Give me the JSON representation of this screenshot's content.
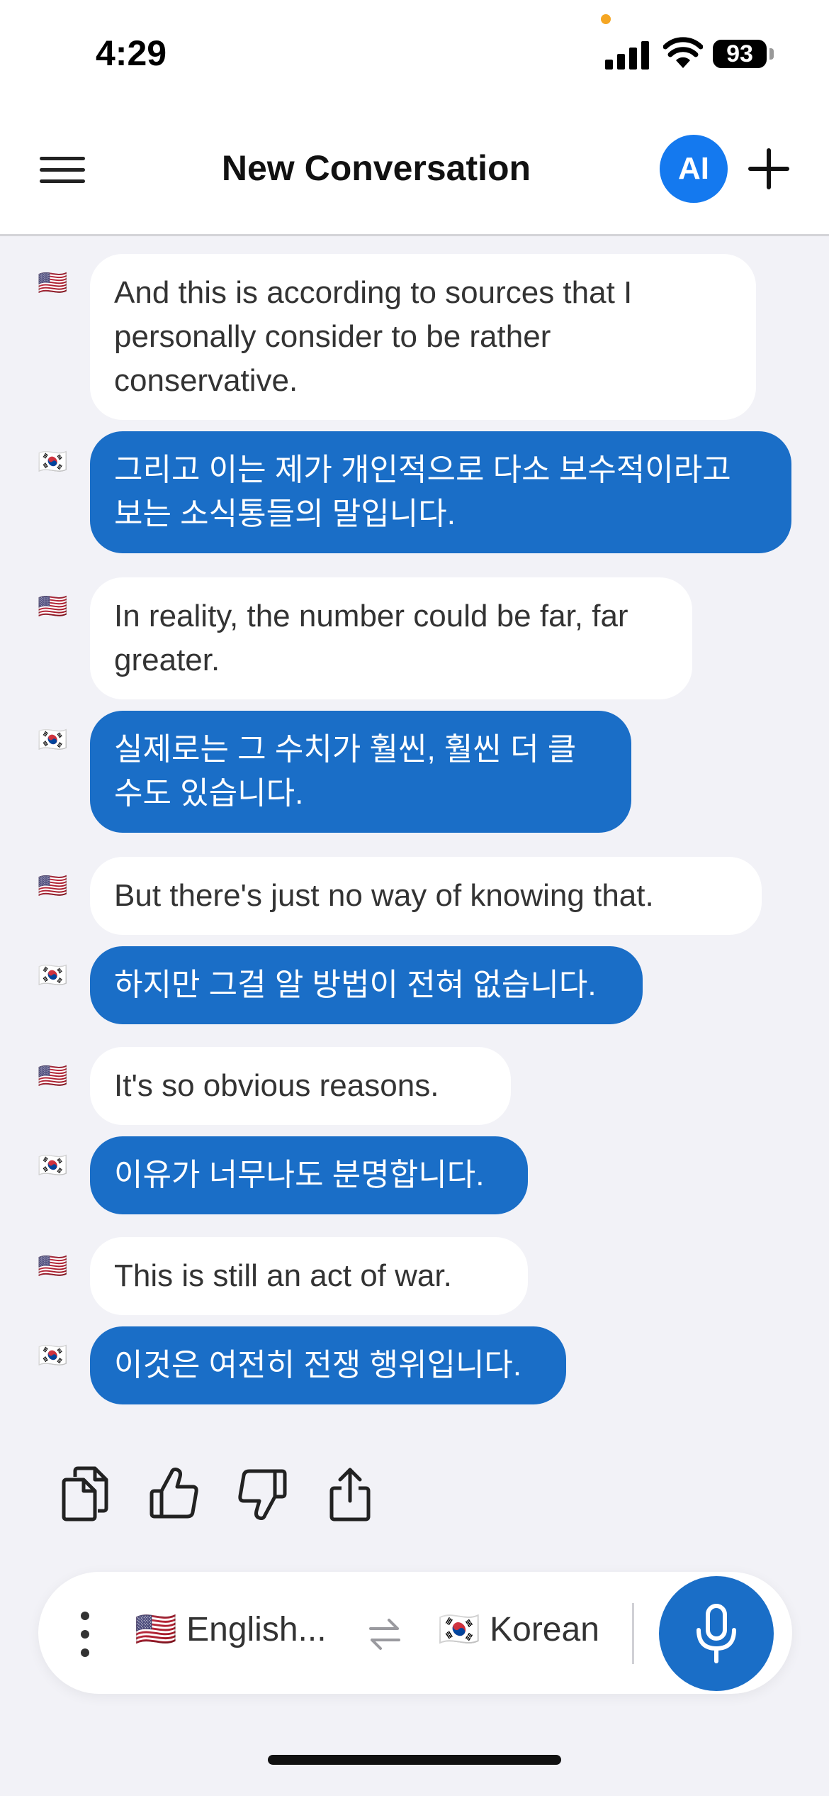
{
  "status_bar": {
    "time": "4:29",
    "battery": "93"
  },
  "header": {
    "title": "New Conversation",
    "ai_label": "AI"
  },
  "messages": [
    {
      "lang": "en",
      "flag": "🇺🇸",
      "text": "And this is according to sources that I personally consider to be rather conservative."
    },
    {
      "lang": "ko",
      "flag": "🇰🇷",
      "text": "그리고 이는 제가 개인적으로 다소 보수적이라고 보는 소식통들의 말입니다."
    },
    {
      "lang": "en",
      "flag": "🇺🇸",
      "text": "In reality, the number could be far, far greater."
    },
    {
      "lang": "ko",
      "flag": "🇰🇷",
      "text": "실제로는 그 수치가 훨씬, 훨씬 더 클 수도 있습니다."
    },
    {
      "lang": "en",
      "flag": "🇺🇸",
      "text": "But there's just no way of knowing that."
    },
    {
      "lang": "ko",
      "flag": "🇰🇷",
      "text": "하지만 그걸 알 방법이 전혀 없습니다."
    },
    {
      "lang": "en",
      "flag": "🇺🇸",
      "text": "It's so obvious reasons."
    },
    {
      "lang": "ko",
      "flag": "🇰🇷",
      "text": "이유가 너무나도 분명합니다."
    },
    {
      "lang": "en",
      "flag": "🇺🇸",
      "text": "This is still an act of war."
    },
    {
      "lang": "ko",
      "flag": "🇰🇷",
      "text": "이것은 여전히 전쟁 행위입니다."
    }
  ],
  "actions": {
    "copy_icon": "copy-icon",
    "like_icon": "thumbs-up-icon",
    "dislike_icon": "thumbs-down-icon",
    "share_icon": "share-icon"
  },
  "language_bar": {
    "source_flag": "🇺🇸",
    "source_label": "English...",
    "target_flag": "🇰🇷",
    "target_label": "Korean",
    "swap_icon": "swap-arrows-icon",
    "mic_icon": "microphone-icon"
  },
  "colors": {
    "accent": "#1479ef",
    "korean_bubble": "#1a6ec7",
    "english_bubble": "#ffffff",
    "background": "#f2f2f7"
  }
}
